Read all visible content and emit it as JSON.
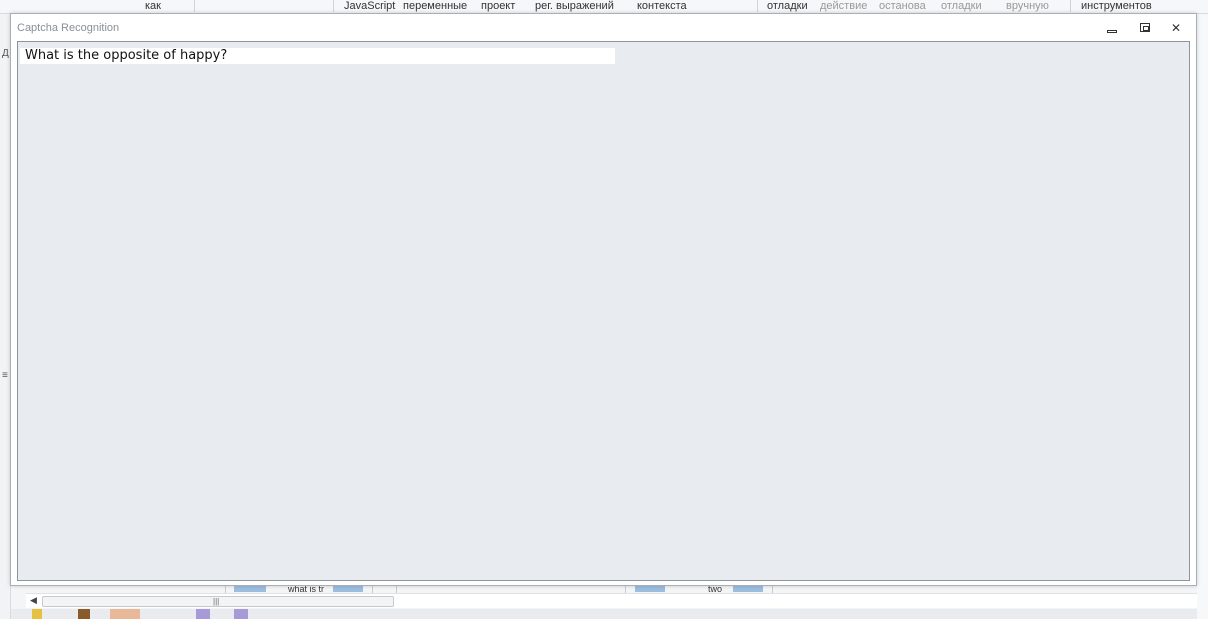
{
  "background_app": {
    "ribbon_labels": [
      {
        "text": "как",
        "dim": false
      },
      {
        "text": "JavaScript",
        "dim": false
      },
      {
        "text": "переменные",
        "dim": false
      },
      {
        "text": "проект",
        "dim": false
      },
      {
        "text": "рег. выражений",
        "dim": false
      },
      {
        "text": "контекста",
        "dim": false
      },
      {
        "text": "отладки",
        "dim": false
      },
      {
        "text": "действие",
        "dim": true
      },
      {
        "text": "останова",
        "dim": true
      },
      {
        "text": "отладки",
        "dim": true
      },
      {
        "text": "вручную",
        "dim": true
      },
      {
        "text": "инструментов",
        "dim": false
      }
    ],
    "table_fragments": [
      "what is tr",
      "two"
    ],
    "left_glyphs": [
      "Д",
      "≡"
    ],
    "scroll_left_glyph": "◀",
    "scroll_grip_glyph": "|||"
  },
  "dialog": {
    "title": "Captcha Recognition",
    "controls": {
      "close_glyph": "✕"
    },
    "question_text": "What is the opposite of happy?"
  },
  "colors": {
    "content_background": "#e8ebef",
    "question_background": "#ffffff",
    "title_text": "#8a8f96"
  }
}
